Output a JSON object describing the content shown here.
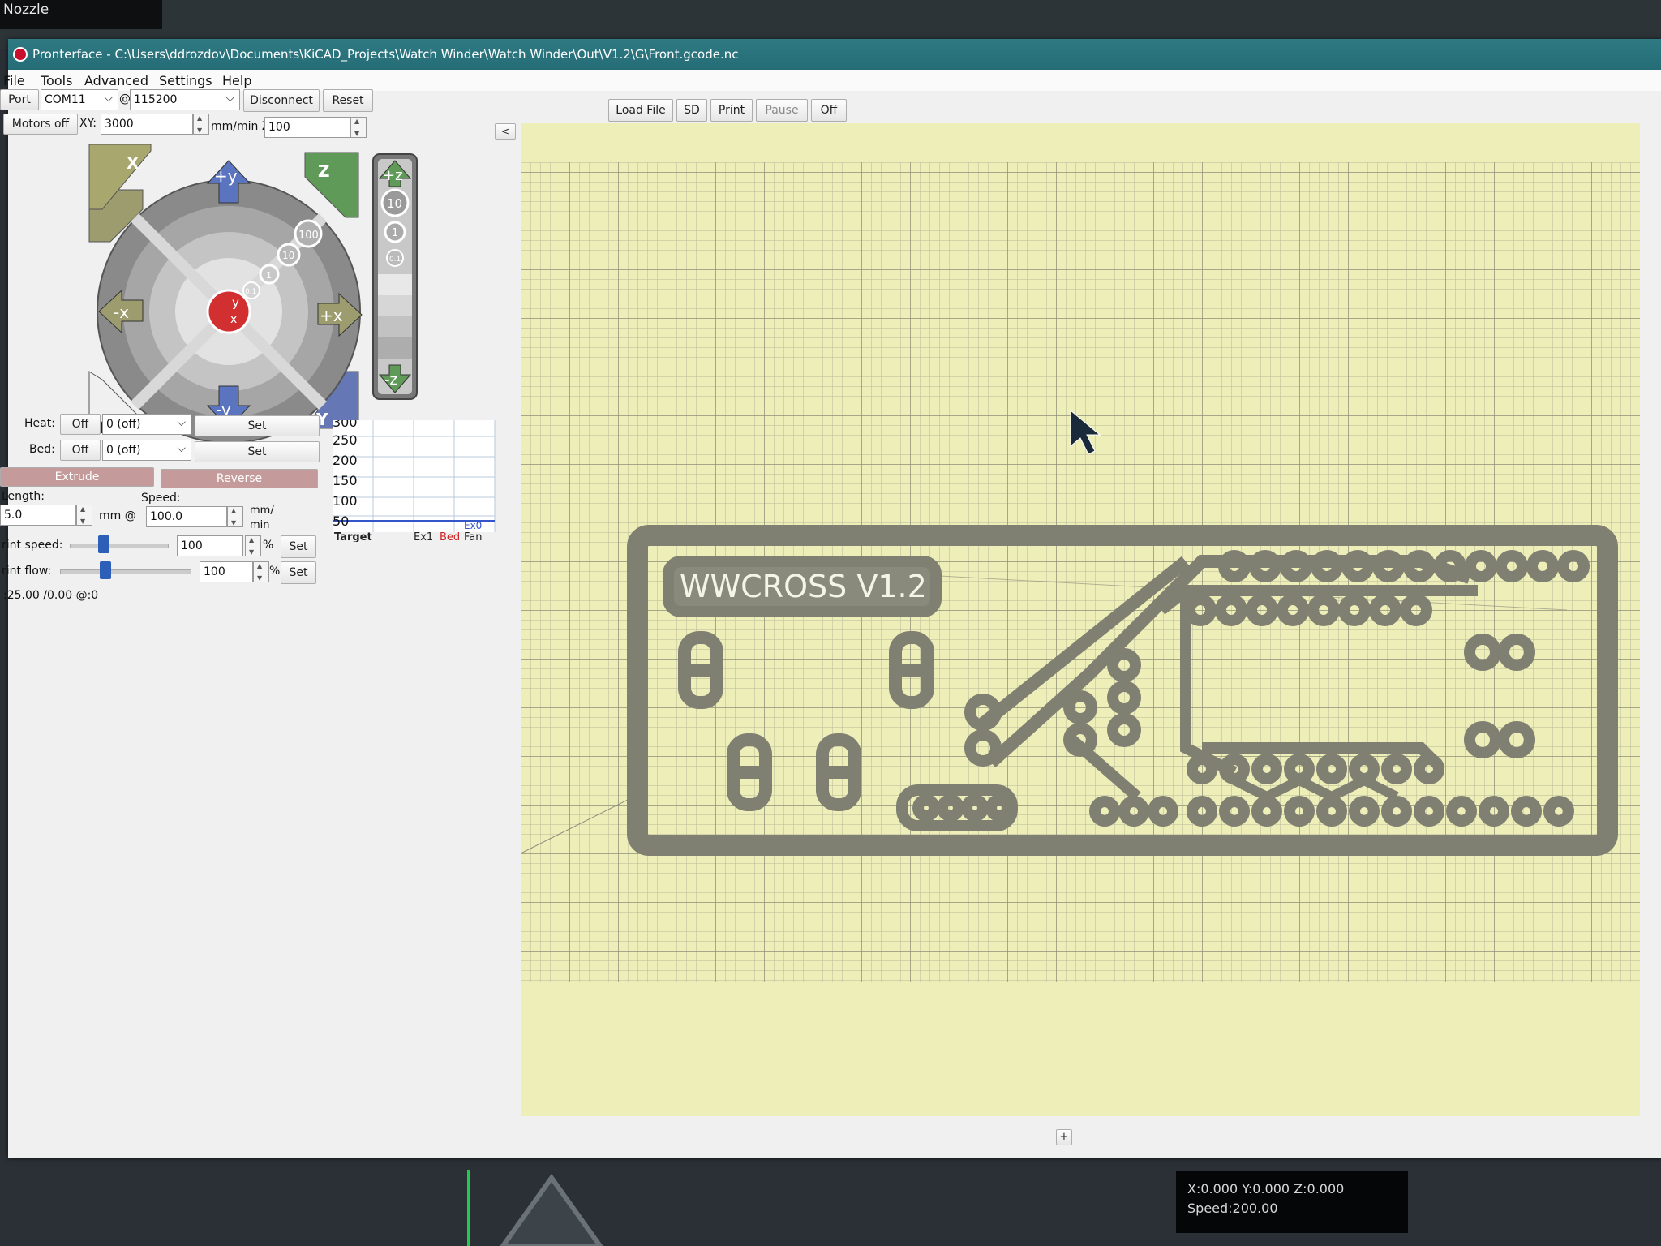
{
  "background_window": {
    "title": "Nozzle"
  },
  "window": {
    "title": "Pronterface - C:\\Users\\ddrozdov\\Documents\\KiCAD_Projects\\Watch Winder\\Watch Winder\\Out\\V1.2\\G\\Front.gcode.nc"
  },
  "menu": [
    "File",
    "Tools",
    "Advanced",
    "Settings",
    "Help"
  ],
  "connection": {
    "port_label": "Port",
    "port_value": "COM11",
    "at": "@",
    "baud_value": "115200",
    "disconnect_label": "Disconnect",
    "reset_label": "Reset"
  },
  "toolbar": {
    "load_file": "Load File",
    "sd": "SD",
    "print": "Print",
    "pause": "Pause",
    "off": "Off"
  },
  "motors": {
    "motors_off_label": "Motors off",
    "xy_label": "XY:",
    "xy_value": "3000",
    "xy_unit": "mm/min Z:",
    "z_value": "100"
  },
  "jog": {
    "home_x": "X",
    "home_z": "Z",
    "home_y": "Y",
    "plus_y": "+y",
    "minus_y": "-y",
    "plus_x": "+x",
    "minus_x": "-x",
    "steps": [
      "100",
      "10",
      "1",
      "0.1"
    ],
    "center_y": "y",
    "center_x": "x",
    "z_plus": "+z",
    "z_minus": "-z",
    "z_steps": [
      "10",
      "1",
      "0.1"
    ]
  },
  "temperature": {
    "heat_label": "Heat:",
    "heat_off": "Off",
    "heat_value": "0 (off)",
    "heat_set": "Set",
    "bed_label": "Bed:",
    "bed_off": "Off",
    "bed_value": "0 (off)",
    "bed_set": "Set"
  },
  "extrude": {
    "extrude_label": "Extrude",
    "reverse_label": "Reverse",
    "length_label": "Length:",
    "speed_label": "Speed:",
    "length_value": "5.0",
    "mm_at": "mm @",
    "speed_value": "100.0",
    "speed_unit_1": "mm/",
    "speed_unit_2": "min"
  },
  "print_speed": {
    "label": "rint speed:",
    "value": "100",
    "unit": "%",
    "set": "Set",
    "slider_fraction": 0.35
  },
  "print_flow": {
    "label": "rint flow:",
    "value": "100",
    "unit": "%",
    "set": "Set",
    "slider_fraction": 0.35
  },
  "status_line": ":25.00 /0.00 @:0",
  "temp_graph": {
    "y_ticks": [
      "300",
      "250",
      "200",
      "150",
      "100",
      "50"
    ],
    "legend": [
      "Target",
      "Ex1",
      "Bed",
      "Fan"
    ],
    "ex0_label": "Ex0",
    "legend_colors": {
      "Target": "#222222",
      "Ex1": "#222222",
      "Bed": "#cc2222",
      "Fan": "#222222",
      "Ex0": "#3355cc"
    }
  },
  "viewport": {
    "collapse_button": "<",
    "expand_button": "+",
    "pcb_label": "WWCROSS V1.2",
    "colors": {
      "bed": "#eeeeb8",
      "grid": "#a8a890",
      "trace": "#7f7f72",
      "background": "#2a3036"
    }
  },
  "status_box": {
    "position": "X:0.000 Y:0.000 Z:0.000",
    "speed": "Speed:200.00"
  }
}
